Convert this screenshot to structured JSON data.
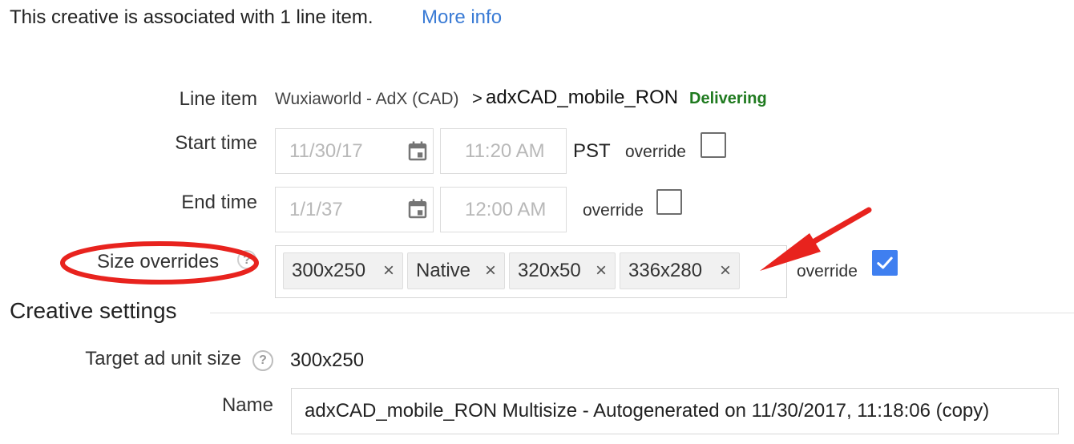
{
  "association": {
    "text": "This creative is associated with 1 line item.",
    "more_info": "More info"
  },
  "line_item": {
    "label": "Line item",
    "parent": "Wuxiaworld - AdX (CAD)",
    "separator": ">",
    "name": "adxCAD_mobile_RON",
    "status": "Delivering",
    "status_color": "#1f7a1f"
  },
  "start_time": {
    "label": "Start time",
    "date": "11/30/17",
    "time": "11:20 AM",
    "timezone": "PST",
    "override_label": "override",
    "override_checked": false
  },
  "end_time": {
    "label": "End time",
    "date": "1/1/37",
    "time": "12:00 AM",
    "override_label": "override",
    "override_checked": false
  },
  "size_overrides": {
    "label": "Size overrides",
    "chips": [
      "300x250",
      "Native",
      "320x50",
      "336x280"
    ],
    "remove_glyph": "×",
    "override_label": "override",
    "override_checked": true,
    "accent": "#3f7ff0"
  },
  "creative_settings": {
    "title": "Creative settings",
    "target_label": "Target ad unit size",
    "help_glyph": "?",
    "target_value": "300x250",
    "name_label": "Name",
    "name_value": "adxCAD_mobile_RON Multisize - Autogenerated on 11/30/2017, 11:18:06 (copy)"
  },
  "annotation": {
    "color": "#e8231e"
  },
  "icons": {
    "calendar": "calendar-icon",
    "help": "help-icon",
    "remove": "close-icon",
    "check": "check-icon"
  }
}
